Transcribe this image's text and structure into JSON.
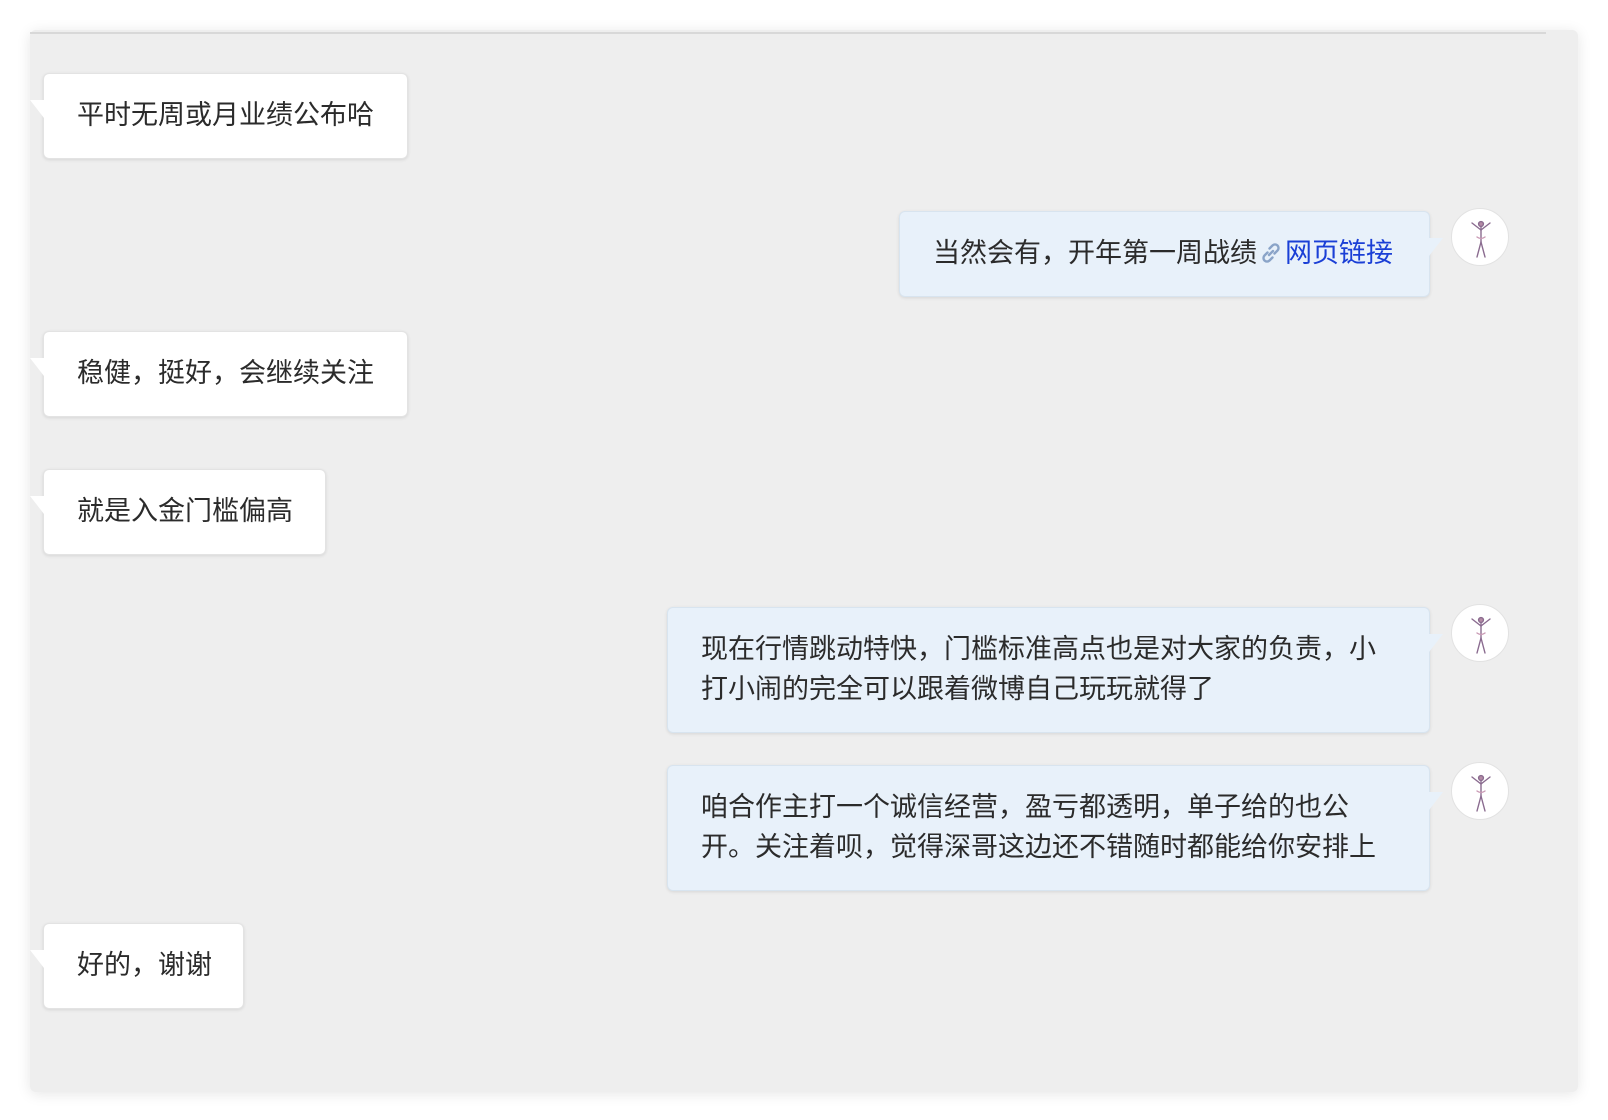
{
  "chat": {
    "messages": [
      {
        "side": "in",
        "text": "平时无周或月业绩公布哈"
      },
      {
        "side": "out",
        "text": "当然会有，开年第一周战绩",
        "link_icon": "link-icon",
        "link_text": "网页链接"
      },
      {
        "side": "in",
        "text": "稳健，挺好，会继续关注"
      },
      {
        "side": "in",
        "text": "就是入金门槛偏高"
      },
      {
        "side": "out",
        "lines": [
          "现在行情跳动特快，门槛标准高点也是对大家的负责，小",
          "打小闹的完全可以跟着微博自己玩玩就得了"
        ]
      },
      {
        "side": "out",
        "lines": [
          "咱合作主打一个诚信经营，盈亏都透明，单子给的也公",
          "开。关注着呗，觉得深哥这边还不错随时都能给你安排上"
        ]
      },
      {
        "side": "in",
        "text": "好的，谢谢"
      }
    ],
    "avatar_icon": "dancer-figure-avatar",
    "colors": {
      "background": "#eeeeee",
      "incoming_bubble": "#ffffff",
      "outgoing_bubble": "#e8f1fa",
      "link": "#1a3fd6"
    }
  }
}
